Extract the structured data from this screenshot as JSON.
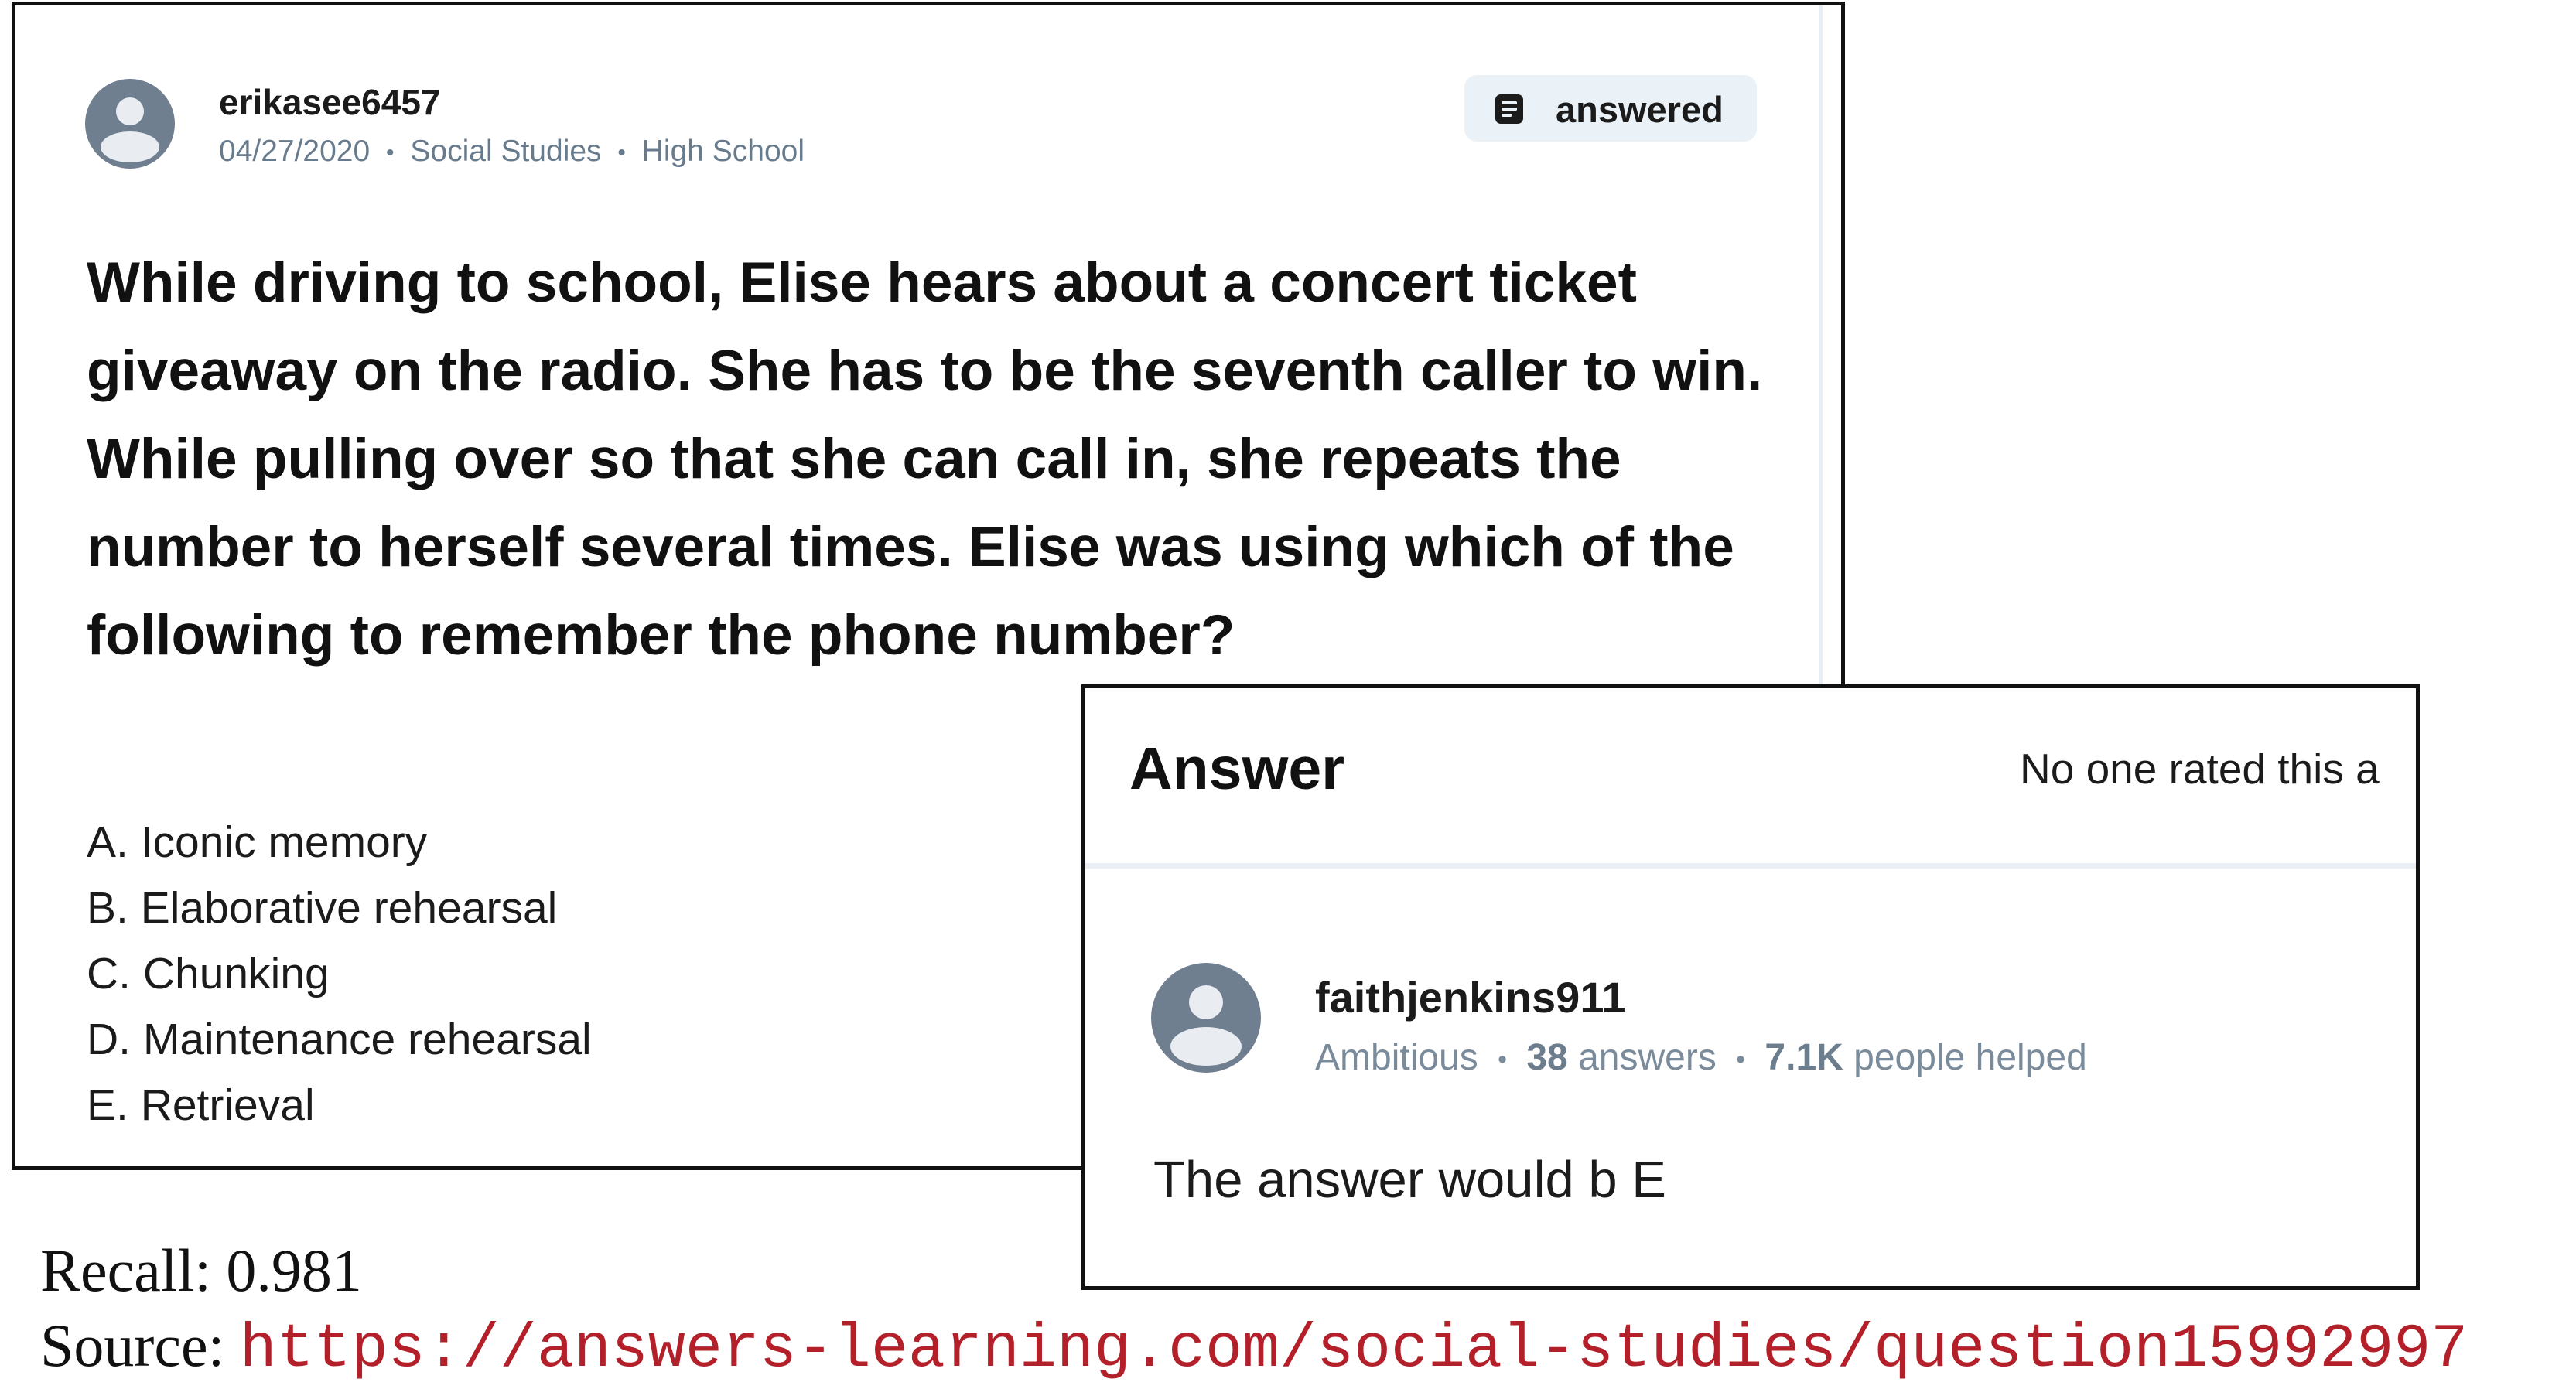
{
  "question": {
    "username": "erikasee6457",
    "date": "04/27/2020",
    "subject": "Social Studies",
    "level": "High School",
    "status_badge": "answered",
    "text": "While driving to school, Elise hears about a concert ticket giveaway on the radio. She has to be the seventh caller to win. While pulling over so that she can call in, she repeats the number to herself several times. Elise was using which of the following to remember the phone number?",
    "options": [
      "A. Iconic memory",
      "B. Elaborative rehearsal",
      "C. Chunking",
      "D. Maintenance rehearsal",
      "E. Retrieval"
    ],
    "icons": {
      "avatar": "user-avatar-icon",
      "badge": "document-icon"
    }
  },
  "answer": {
    "title": "Answer",
    "rating_text": "No one rated this a",
    "username": "faithjenkins911",
    "rank": "Ambitious",
    "answers_count": "38",
    "answers_label": "answers",
    "helped_count": "7.1K",
    "helped_label": "people helped",
    "body": "The answer would b E",
    "icons": {
      "avatar": "user-avatar-icon"
    }
  },
  "footer": {
    "recall_label": "Recall: 0.981",
    "source_label": "Source:",
    "source_url": "https://answers-learning.com/social-studies/question15992997"
  },
  "colors": {
    "meta_gray": "#687b8c",
    "badge_bg": "#ebf2f7",
    "avatar": "#6f7f90",
    "url_red": "#b3202a"
  }
}
